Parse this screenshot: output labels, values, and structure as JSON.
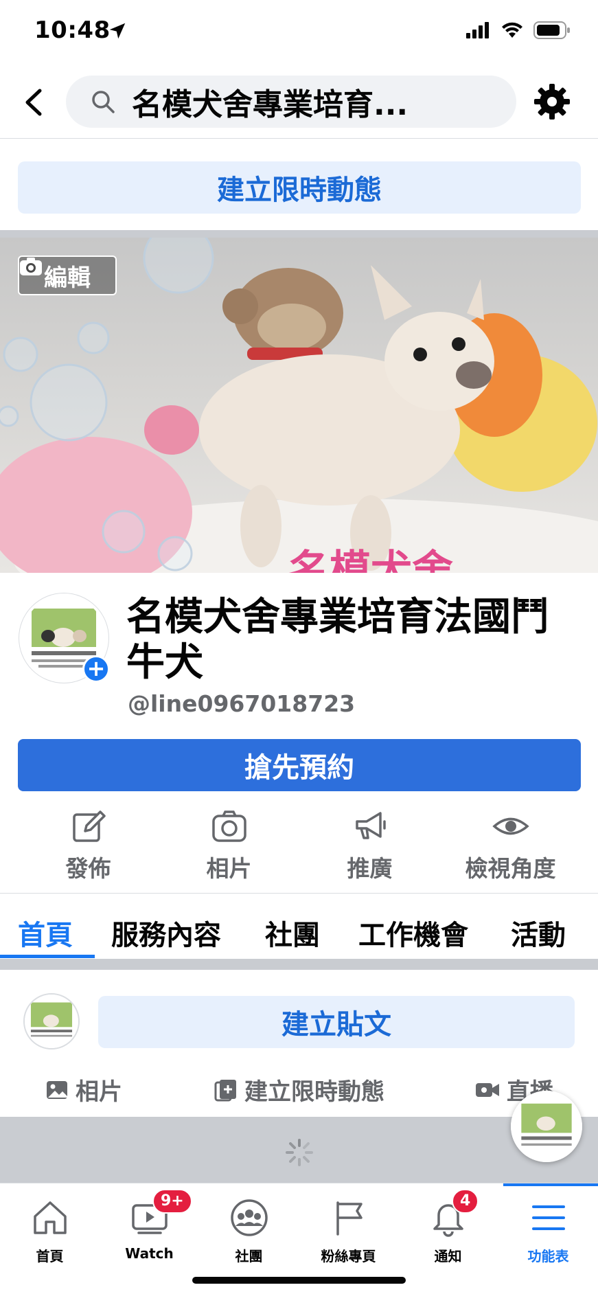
{
  "status_bar": {
    "time": "10:48"
  },
  "top_nav": {
    "search_text": "名模犬舍專業培育..."
  },
  "story_create": {
    "label": "建立限時動態"
  },
  "cover": {
    "edit_label": "編輯",
    "watermark": "名模犬舍"
  },
  "profile": {
    "name": "名模犬舍專業培育法國鬥牛犬",
    "handle": "@line0967018723",
    "avatar_text": "法國鬥牛犬專賣店"
  },
  "cta": {
    "label": "搶先預約"
  },
  "actions": [
    {
      "label": "發佈",
      "icon": "compose-icon"
    },
    {
      "label": "相片",
      "icon": "camera-icon"
    },
    {
      "label": "推廣",
      "icon": "megaphone-icon"
    },
    {
      "label": "檢視角度",
      "icon": "eye-icon"
    }
  ],
  "tabs": [
    {
      "label": "首頁",
      "active": true
    },
    {
      "label": "服務內容"
    },
    {
      "label": "社團"
    },
    {
      "label": "工作機會"
    },
    {
      "label": "活動"
    }
  ],
  "composer": {
    "create_post_label": "建立貼文",
    "options": [
      {
        "label": "相片",
        "icon": "photo-icon"
      },
      {
        "label": "建立限時動態",
        "icon": "story-icon"
      },
      {
        "label": "直播",
        "icon": "live-video-icon"
      }
    ]
  },
  "bottom_nav": [
    {
      "label": "首頁",
      "icon": "home-icon"
    },
    {
      "label": "Watch",
      "icon": "watch-icon",
      "badge": "9+"
    },
    {
      "label": "社團",
      "icon": "groups-icon"
    },
    {
      "label": "粉絲專頁",
      "icon": "flag-icon"
    },
    {
      "label": "通知",
      "icon": "bell-icon",
      "badge": "4"
    },
    {
      "label": "功能表",
      "icon": "menu-icon",
      "active": true
    }
  ],
  "colors": {
    "accent": "#1877f2",
    "cta": "#2d6fdc",
    "badge": "#e41e3f",
    "soft_button": "#e7f0fd"
  }
}
